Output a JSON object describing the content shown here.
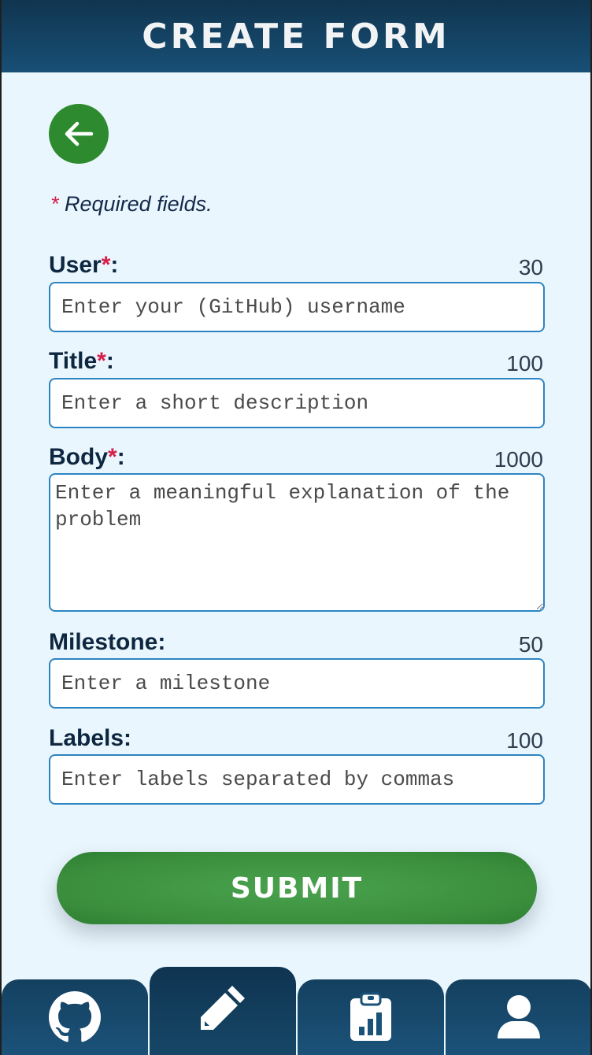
{
  "header": {
    "title": "CREATE FORM"
  },
  "back_button": {
    "icon": "arrow-left-icon"
  },
  "required_note": {
    "star": "*",
    "text": "Required fields."
  },
  "fields": [
    {
      "label": "User",
      "required": "*",
      "colon": ":",
      "limit": "30",
      "placeholder": "Enter your (GitHub) username"
    },
    {
      "label": "Title",
      "required": "*",
      "colon": ":",
      "limit": "100",
      "placeholder": "Enter a short description"
    },
    {
      "label": "Body",
      "required": "*",
      "colon": ":",
      "limit": "1000",
      "placeholder": "Enter a meaningful explanation of the problem"
    },
    {
      "label": "Milestone",
      "colon": ":",
      "limit": "50",
      "placeholder": "Enter a milestone"
    },
    {
      "label": "Labels",
      "colon": ":",
      "limit": "100",
      "placeholder": "Enter labels separated by commas"
    }
  ],
  "submit": {
    "label": "SUBMIT"
  },
  "tabs": [
    {
      "icon": "github-icon"
    },
    {
      "icon": "pencil-icon",
      "active": "true"
    },
    {
      "icon": "clipboard-chart-icon"
    },
    {
      "icon": "user-icon"
    }
  ],
  "colors": {
    "header": "#184f76",
    "background": "#eaf6fd",
    "accent_green": "#2d8a2e",
    "required_red": "#d61f4a",
    "input_border": "#2b85c2"
  }
}
